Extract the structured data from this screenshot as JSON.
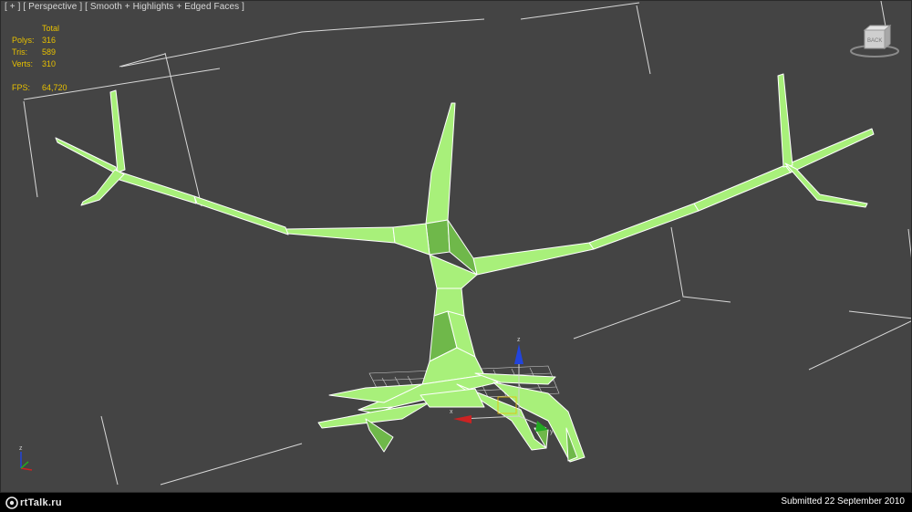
{
  "viewport": {
    "label": {
      "menu": "[ + ]",
      "view": "[ Perspective ]",
      "shading": "[ Smooth + Highlights + Edged Faces ]"
    },
    "stats": {
      "header": "Total",
      "polys_label": "Polys:",
      "polys_value": "316",
      "tris_label": "Tris:",
      "tris_value": "589",
      "verts_label": "Verts:",
      "verts_value": "310",
      "fps_label": "FPS:",
      "fps_value": "64,720"
    },
    "colors": {
      "background": "#444444",
      "mesh_fill": "#a8f07a",
      "mesh_shade": "#6fb84a",
      "mesh_edge": "#ffffff",
      "stat_text": "#e7c000",
      "axis_x": "#cc2222",
      "axis_y": "#22aa22",
      "axis_z": "#2244dd"
    },
    "icons": {
      "viewcube": "viewcube-icon",
      "gizmo": "transform-gizmo-icon",
      "world_axis": "world-axis-icon"
    }
  },
  "footer": {
    "logo_text": "rtTalk.ru",
    "submitted": "Submitted 22 September 2010"
  }
}
